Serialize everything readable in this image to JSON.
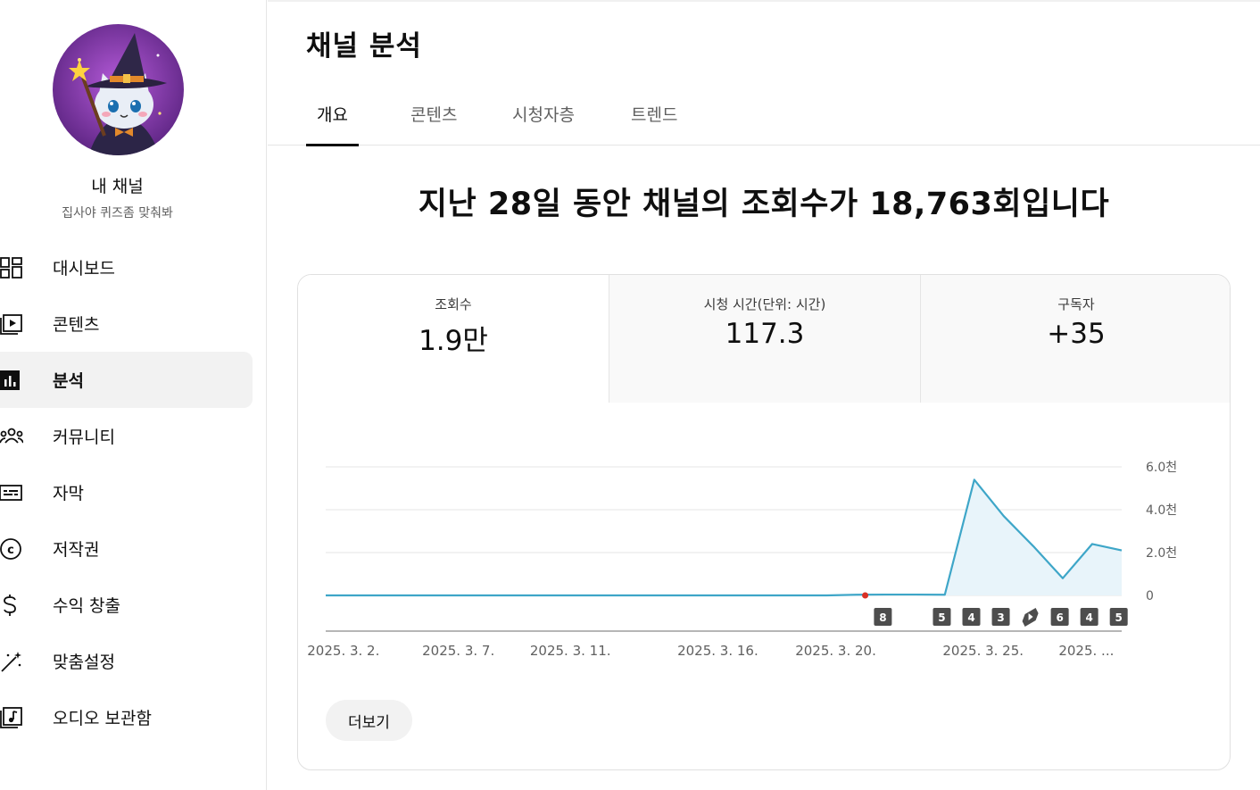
{
  "sidebar": {
    "channel_name": "내 채널",
    "channel_handle": "집사야 퀴즈좀 맞춰봐",
    "items": [
      {
        "label": "대시보드",
        "icon": "dashboard-icon"
      },
      {
        "label": "콘텐츠",
        "icon": "content-icon"
      },
      {
        "label": "분석",
        "icon": "analytics-icon",
        "active": true
      },
      {
        "label": "커뮤니티",
        "icon": "community-icon"
      },
      {
        "label": "자막",
        "icon": "subtitles-icon"
      },
      {
        "label": "저작권",
        "icon": "copyright-icon"
      },
      {
        "label": "수익 창출",
        "icon": "monetization-icon"
      },
      {
        "label": "맞춤설정",
        "icon": "customization-icon"
      },
      {
        "label": "오디오 보관함",
        "icon": "audio-library-icon"
      }
    ]
  },
  "page": {
    "title": "채널 분석",
    "tabs": [
      "개요",
      "콘텐츠",
      "시청자층",
      "트렌드"
    ],
    "active_tab": "개요",
    "headline": "지난 28일 동안 채널의 조회수가 18,763회입니다"
  },
  "metrics": [
    {
      "label": "조회수",
      "value": "1.9만"
    },
    {
      "label": "시청 시간(단위: 시간)",
      "value": "117.3"
    },
    {
      "label": "구독자",
      "value": "+35"
    }
  ],
  "more_button": "더보기",
  "colors": {
    "line": "#3ea6c8",
    "area": "#e8f4fa",
    "marker": "#d93025",
    "badge": "#4d4d4d"
  },
  "chart_data": {
    "type": "area",
    "x": [
      "2025-03-01",
      "2025-03-02",
      "2025-03-03",
      "2025-03-04",
      "2025-03-05",
      "2025-03-06",
      "2025-03-07",
      "2025-03-08",
      "2025-03-09",
      "2025-03-10",
      "2025-03-11",
      "2025-03-12",
      "2025-03-13",
      "2025-03-14",
      "2025-03-15",
      "2025-03-16",
      "2025-03-17",
      "2025-03-18",
      "2025-03-19",
      "2025-03-20",
      "2025-03-21",
      "2025-03-22",
      "2025-03-23",
      "2025-03-24",
      "2025-03-25",
      "2025-03-26",
      "2025-03-27",
      "2025-03-28"
    ],
    "series": [
      {
        "values": [
          0,
          0,
          0,
          0,
          0,
          0,
          0,
          0,
          0,
          0,
          0,
          0,
          0,
          0,
          0,
          0,
          0,
          0,
          30,
          40,
          40,
          30,
          5400,
          3700,
          2300,
          800,
          2400,
          2100
        ]
      }
    ],
    "x_tick_labels": [
      "2025. 3. 2.",
      "2025. 3. 7.",
      "2025. 3. 11.",
      "2025. 3. 16.",
      "2025. 3. 20.",
      "2025. 3. 25.",
      "2025. ..."
    ],
    "x_tick_index": [
      0.6,
      4.5,
      8.3,
      13.3,
      17.3,
      22.3,
      25.8
    ],
    "y_tick_labels": [
      "0",
      "2.0천",
      "4.0천",
      "6.0천"
    ],
    "y_tick_values": [
      0,
      2000,
      4000,
      6000
    ],
    "ylim": [
      0,
      6000
    ],
    "grid": true,
    "marker_index": 18.3,
    "upload_badges": [
      {
        "index": 18.9,
        "label": "8"
      },
      {
        "index": 20.9,
        "label": "5"
      },
      {
        "index": 21.9,
        "label": "4"
      },
      {
        "index": 22.9,
        "label": "3"
      },
      {
        "index": 23.9,
        "label": "shorts"
      },
      {
        "index": 24.9,
        "label": "6"
      },
      {
        "index": 25.9,
        "label": "4"
      },
      {
        "index": 26.9,
        "label": "5"
      }
    ]
  }
}
